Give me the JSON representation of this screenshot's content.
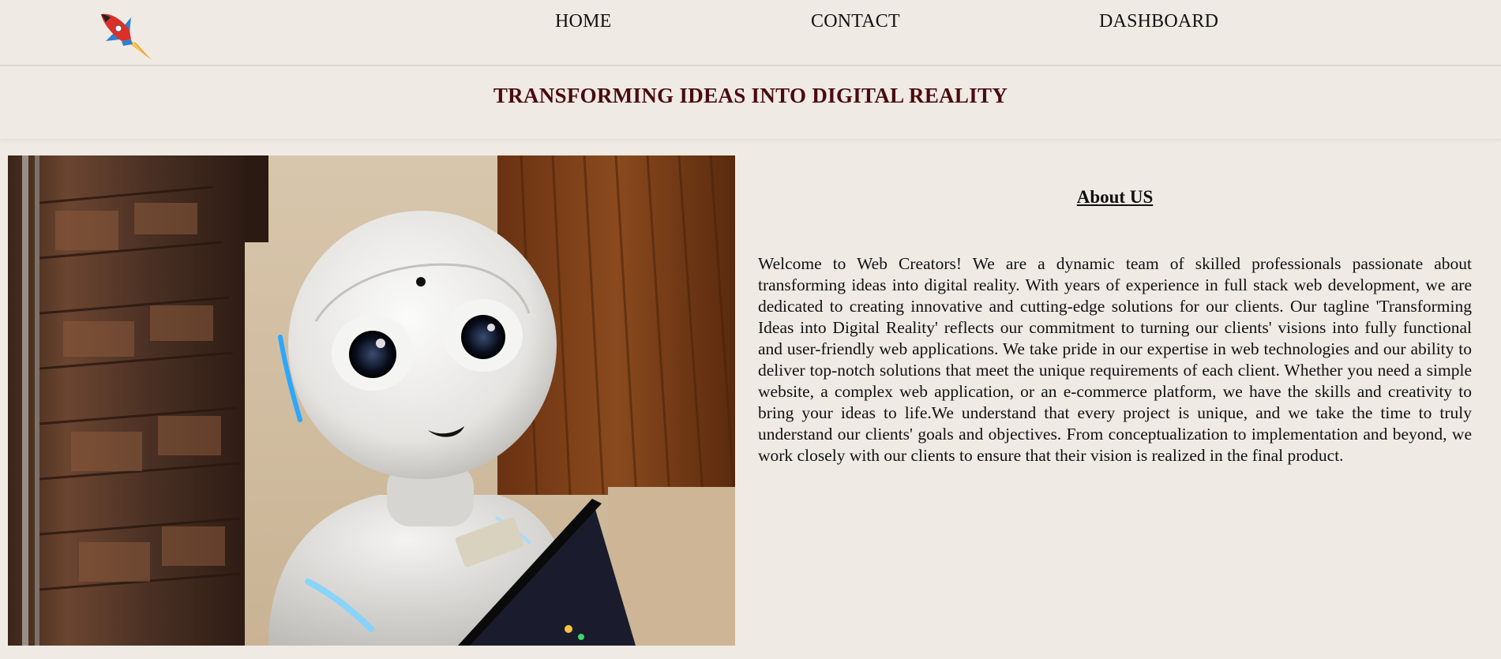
{
  "nav": {
    "logo_icon": "rocket-icon",
    "items": [
      {
        "label": "HOME"
      },
      {
        "label": "CONTACT"
      },
      {
        "label": "DASHBOARD"
      }
    ]
  },
  "hero": {
    "tagline": "TRANSFORMING IDEAS INTO DIGITAL REALITY",
    "image_icon": "robot-image"
  },
  "about": {
    "heading": "About US",
    "body": "Welcome to Web Creators! We are a dynamic team of skilled professionals passionate about transforming ideas into digital reality. With years of experience in full stack web development, we are dedicated to creating innovative and cutting-edge solutions for our clients. Our tagline 'Transforming Ideas into Digital Reality' reflects our commitment to turning our clients' visions into fully functional and user-friendly web applications. We take pride in our expertise in web technologies and our ability to deliver top-notch solutions that meet the unique requirements of each client. Whether you need a simple website, a complex web application, or an e-commerce platform, we have the skills and creativity to bring your ideas to life.We understand that every project is unique, and we take the time to truly understand our clients' goals and objectives. From conceptualization to implementation and beyond, we work closely with our clients to ensure that their vision is realized in the final product."
  },
  "colors": {
    "background": "#efeae4",
    "tagline": "#4a0a0f",
    "text": "#111111"
  }
}
